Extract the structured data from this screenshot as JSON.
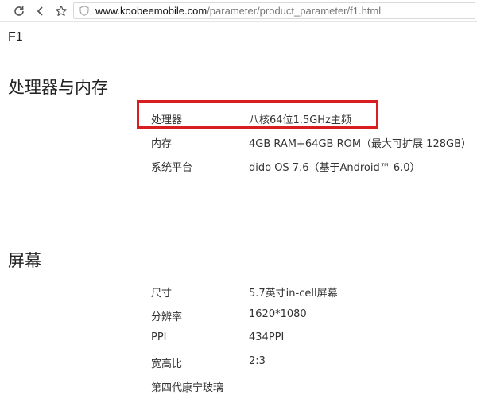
{
  "browser": {
    "url_host": "www.koobeemobile.com",
    "url_path": "/parameter/product_parameter/f1.html"
  },
  "page": {
    "product_name": "F1",
    "sections": [
      {
        "title": "处理器与内存",
        "rows": [
          {
            "label": "处理器",
            "value": "八核64位1.5GHz主频"
          },
          {
            "label": "内存",
            "value": "4GB RAM+64GB ROM（最大可扩展 128GB）"
          },
          {
            "label": "系统平台",
            "value": "dido OS 7.6（基于Android™ 6.0）"
          }
        ]
      },
      {
        "title": "屏幕",
        "rows": [
          {
            "label": "尺寸",
            "value": "5.7英寸in-cell屏幕"
          },
          {
            "label": "分辨率",
            "value": "1620*1080"
          },
          {
            "label": "PPI",
            "value": "434PPI"
          },
          {
            "label": "宽高比",
            "value": "2:3"
          },
          {
            "label": "第四代康宁玻璃",
            "value": ""
          }
        ]
      }
    ]
  },
  "highlight_color": "#d81e1e"
}
